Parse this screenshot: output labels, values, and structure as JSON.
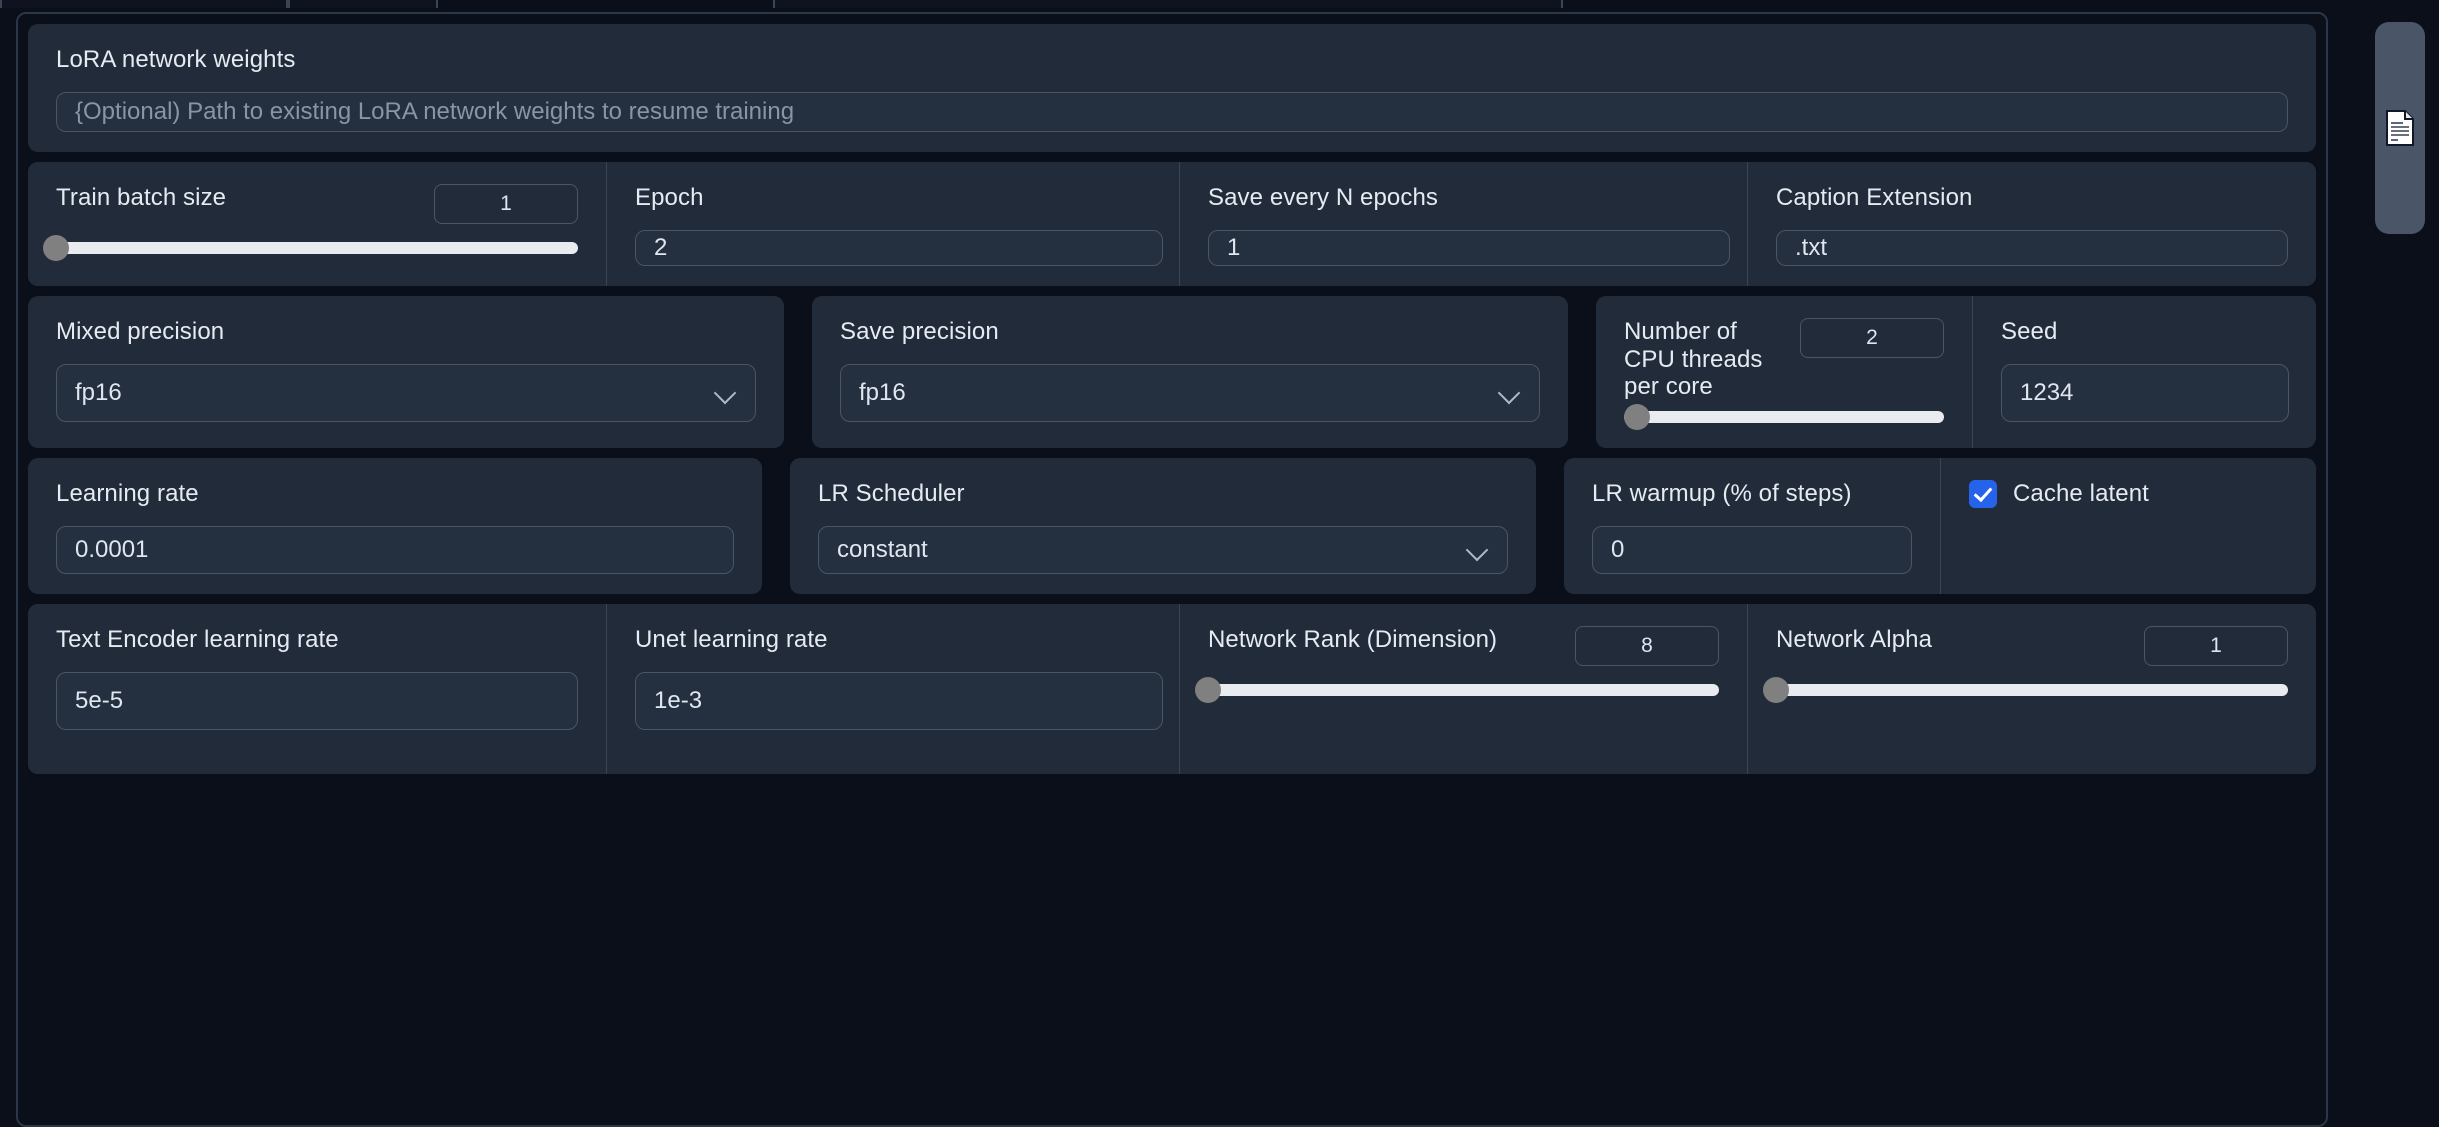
{
  "window": {
    "background": "#0b0f19",
    "panel_color": "#212b3a",
    "accent_color": "#2563eb",
    "slider_track_color": "#e9ecef",
    "slider_knob_color": "#808080"
  },
  "tabs": [
    {
      "name": "tab-stub-1"
    },
    {
      "name": "tab-stub-2"
    },
    {
      "name": "tab-stub-3"
    }
  ],
  "side_button": {
    "icon": "document-icon",
    "label": ""
  },
  "lora_weights": {
    "label": "LoRA network weights",
    "placeholder": "{Optional) Path to existing LoRA network weights to resume training",
    "value": ""
  },
  "row_basic": {
    "train_batch_size": {
      "label": "Train batch size",
      "value": "1",
      "slider_percent": 0
    },
    "epoch": {
      "label": "Epoch",
      "value": "2"
    },
    "save_every_n_epochs": {
      "label": "Save every N epochs",
      "value": "1"
    },
    "caption_extension": {
      "label": "Caption Extension",
      "value": ".txt"
    }
  },
  "row_precision": {
    "mixed_precision": {
      "label": "Mixed precision",
      "value": "fp16",
      "icon": "chevron-down-icon"
    },
    "save_precision": {
      "label": "Save precision",
      "value": "fp16",
      "icon": "chevron-down-icon"
    },
    "cpu_threads": {
      "label": "Number of CPU threads per core",
      "value": "2",
      "slider_percent": 4
    },
    "seed": {
      "label": "Seed",
      "value": "1234"
    }
  },
  "row_lr": {
    "learning_rate": {
      "label": "Learning rate",
      "value": "0.0001"
    },
    "lr_scheduler": {
      "label": "LR Scheduler",
      "value": "constant",
      "icon": "chevron-down-icon"
    },
    "lr_warmup": {
      "label": "LR warmup (% of steps)",
      "value": "0"
    },
    "cache_latent": {
      "label": "Cache latent",
      "checked": true
    }
  },
  "row_network": {
    "text_encoder_lr": {
      "label": "Text Encoder learning rate",
      "value": "5e-5"
    },
    "unet_lr": {
      "label": "Unet learning rate",
      "value": "1e-3"
    },
    "network_rank": {
      "label": "Network Rank (Dimension)",
      "value": "8",
      "slider_percent": 0
    },
    "network_alpha": {
      "label": "Network Alpha",
      "value": "1",
      "slider_percent": 0
    }
  }
}
